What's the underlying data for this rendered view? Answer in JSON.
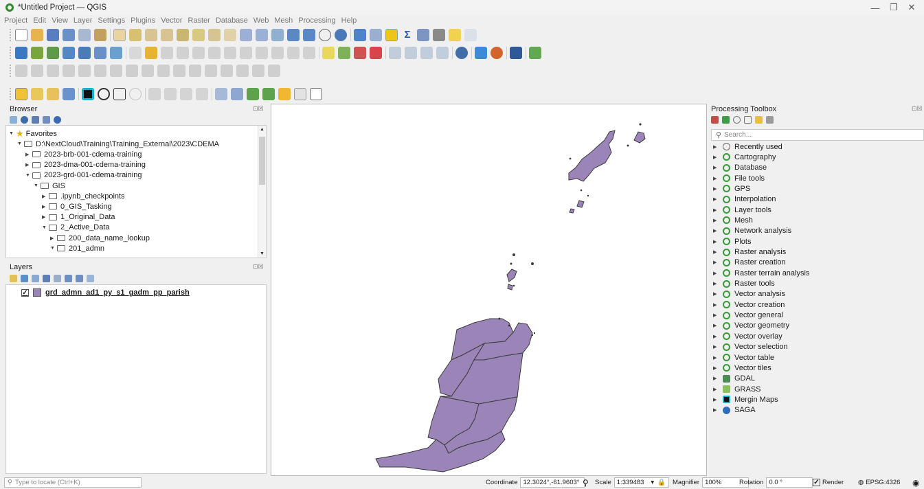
{
  "window": {
    "title": "*Untitled Project — QGIS"
  },
  "menu": [
    "Project",
    "Edit",
    "View",
    "Layer",
    "Settings",
    "Plugins",
    "Vector",
    "Raster",
    "Database",
    "Web",
    "Mesh",
    "Processing",
    "Help"
  ],
  "browser": {
    "title": "Browser",
    "tree": [
      {
        "label": "Favorites",
        "level": 0,
        "expanded": true,
        "type": "star"
      },
      {
        "label": "D:\\NextCloud\\Training\\Training_External\\2023\\CDEMA",
        "level": 1,
        "expanded": true,
        "type": "folder"
      },
      {
        "label": "2023-brb-001-cdema-training",
        "level": 2,
        "expanded": false,
        "type": "folder"
      },
      {
        "label": "2023-dma-001-cdema-training",
        "level": 2,
        "expanded": false,
        "type": "folder"
      },
      {
        "label": "2023-grd-001-cdema-training",
        "level": 2,
        "expanded": true,
        "type": "folder"
      },
      {
        "label": "GIS",
        "level": 3,
        "expanded": true,
        "type": "folder"
      },
      {
        "label": ".ipynb_checkpoints",
        "level": 4,
        "expanded": false,
        "type": "folder"
      },
      {
        "label": "0_GIS_Tasking",
        "level": 4,
        "expanded": false,
        "type": "folder"
      },
      {
        "label": "1_Original_Data",
        "level": 4,
        "expanded": false,
        "type": "folder"
      },
      {
        "label": "2_Active_Data",
        "level": 4,
        "expanded": true,
        "type": "folder"
      },
      {
        "label": "200_data_name_lookup",
        "level": 5,
        "expanded": false,
        "type": "folder"
      },
      {
        "label": "201_admn",
        "level": 5,
        "expanded": true,
        "type": "folder"
      }
    ]
  },
  "layers": {
    "title": "Layers",
    "items": [
      {
        "name": "grd_admn_ad1_py_s1_gadm_pp_parish",
        "checked": true,
        "color": "#9b85b8"
      }
    ]
  },
  "toolbox": {
    "title": "Processing Toolbox",
    "search_placeholder": "Search...",
    "items": [
      {
        "label": "Recently used",
        "icon": "clock-icon"
      },
      {
        "label": "Cartography",
        "icon": "qgis-icon"
      },
      {
        "label": "Database",
        "icon": "qgis-icon"
      },
      {
        "label": "File tools",
        "icon": "qgis-icon"
      },
      {
        "label": "GPS",
        "icon": "qgis-icon"
      },
      {
        "label": "Interpolation",
        "icon": "qgis-icon"
      },
      {
        "label": "Layer tools",
        "icon": "qgis-icon"
      },
      {
        "label": "Mesh",
        "icon": "qgis-icon"
      },
      {
        "label": "Network analysis",
        "icon": "qgis-icon"
      },
      {
        "label": "Plots",
        "icon": "qgis-icon"
      },
      {
        "label": "Raster analysis",
        "icon": "qgis-icon"
      },
      {
        "label": "Raster creation",
        "icon": "qgis-icon"
      },
      {
        "label": "Raster terrain analysis",
        "icon": "qgis-icon"
      },
      {
        "label": "Raster tools",
        "icon": "qgis-icon"
      },
      {
        "label": "Vector analysis",
        "icon": "qgis-icon"
      },
      {
        "label": "Vector creation",
        "icon": "qgis-icon"
      },
      {
        "label": "Vector general",
        "icon": "qgis-icon"
      },
      {
        "label": "Vector geometry",
        "icon": "qgis-icon"
      },
      {
        "label": "Vector overlay",
        "icon": "qgis-icon"
      },
      {
        "label": "Vector selection",
        "icon": "qgis-icon"
      },
      {
        "label": "Vector table",
        "icon": "qgis-icon"
      },
      {
        "label": "Vector tiles",
        "icon": "qgis-icon"
      },
      {
        "label": "GDAL",
        "icon": "gdal-icon"
      },
      {
        "label": "GRASS",
        "icon": "grass-icon"
      },
      {
        "label": "Mergin Maps",
        "icon": "mergin-icon"
      },
      {
        "label": "SAGA",
        "icon": "saga-icon"
      }
    ]
  },
  "status": {
    "locator_placeholder": "Type to locate (Ctrl+K)",
    "coordinate_label": "Coordinate",
    "coordinate_value": "12.3024°,-61.9603°",
    "scale_label": "Scale",
    "scale_value": "1:339483",
    "magnifier_label": "Magnifier",
    "magnifier_value": "100%",
    "rotation_label": "Rotation",
    "rotation_value": "0.0 °",
    "render_label": "Render",
    "crs": "EPSG:4326"
  },
  "colors": {
    "feature_fill": "#9b85b8",
    "accent": "#2e8b2e"
  }
}
